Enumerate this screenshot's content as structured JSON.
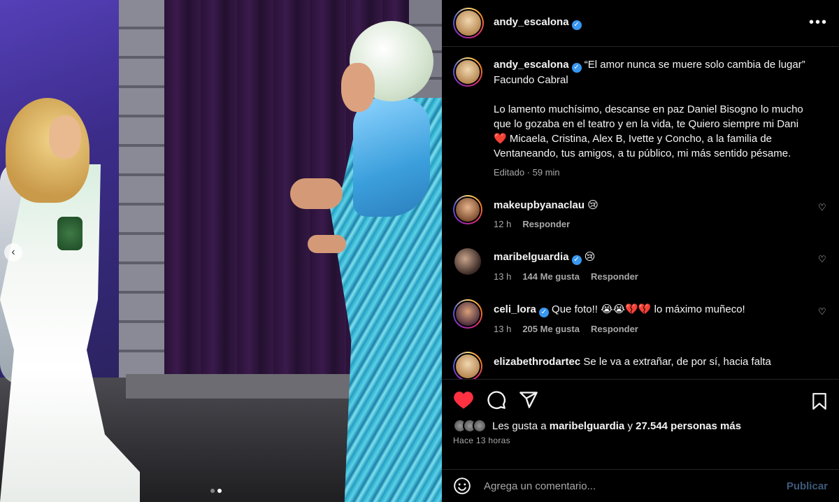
{
  "post": {
    "author": "andy_escalona",
    "carousel": {
      "total_slides": 2,
      "current_slide": 2
    }
  },
  "caption": {
    "username": "andy_escalona",
    "text": "“El amor nunca se muere solo cambia de lugar” Facundo Cabral\n\nLo lamento muchísimo, descanse en paz Daniel Bisogno lo mucho que lo gozaba en el teatro y en la vida, te Quiero siempre mi Dani ❤️ Micaela, Cristina, Alex B, Ivette y Concho, a la familia de Ventaneando, tus amigos, a tu público, mi más sentido pésame.",
    "edited": "Editado · 59 min"
  },
  "comments": [
    {
      "username": "makeupbyanaclau",
      "verified": false,
      "text": "😢",
      "time": "12 h",
      "likes": "",
      "reply": "Responder"
    },
    {
      "username": "maribelguardia",
      "verified": true,
      "text": "😢",
      "time": "13 h",
      "likes": "144 Me gusta",
      "reply": "Responder"
    },
    {
      "username": "celi_lora",
      "verified": true,
      "text": "Que foto!! 😭😭💔💔 lo máximo muñeco!",
      "time": "13 h",
      "likes": "205 Me gusta",
      "reply": "Responder"
    },
    {
      "username": "elizabethrodartec",
      "verified": false,
      "text": "Se le va a extrañar, de por sí, hacia falta",
      "time": "",
      "likes": "",
      "reply": ""
    }
  ],
  "likes": {
    "prefix": "Les gusta a ",
    "user": "maribelguardia",
    "mid": " y ",
    "count": "27.544 personas más"
  },
  "timeago": "Hace 13 horas",
  "add_comment": {
    "placeholder": "Agrega un comentario...",
    "publish": "Publicar"
  },
  "colors": {
    "like_red": "#ff3040",
    "verified_blue": "#3897f0",
    "publish_disabled": "#3d5a7a"
  }
}
